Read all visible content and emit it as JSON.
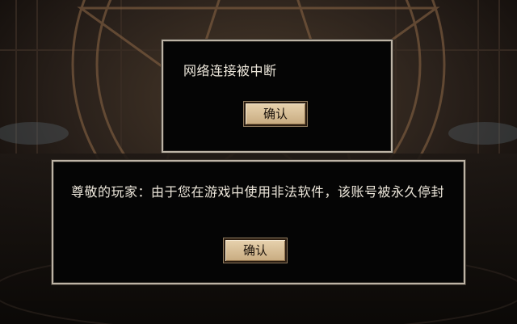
{
  "dialogs": {
    "network": {
      "message": "网络连接被中断",
      "confirm_label": "确认"
    },
    "ban": {
      "message": "尊敬的玩家：由于您在游戏中使用非法软件，该账号被永久停封",
      "confirm_label": "确认"
    }
  },
  "colors": {
    "background": "#1a1512",
    "dialog_bg": "#050505",
    "dialog_border": "#bdb4a6",
    "button_face": "#d9c29c",
    "text": "#ece6da"
  }
}
